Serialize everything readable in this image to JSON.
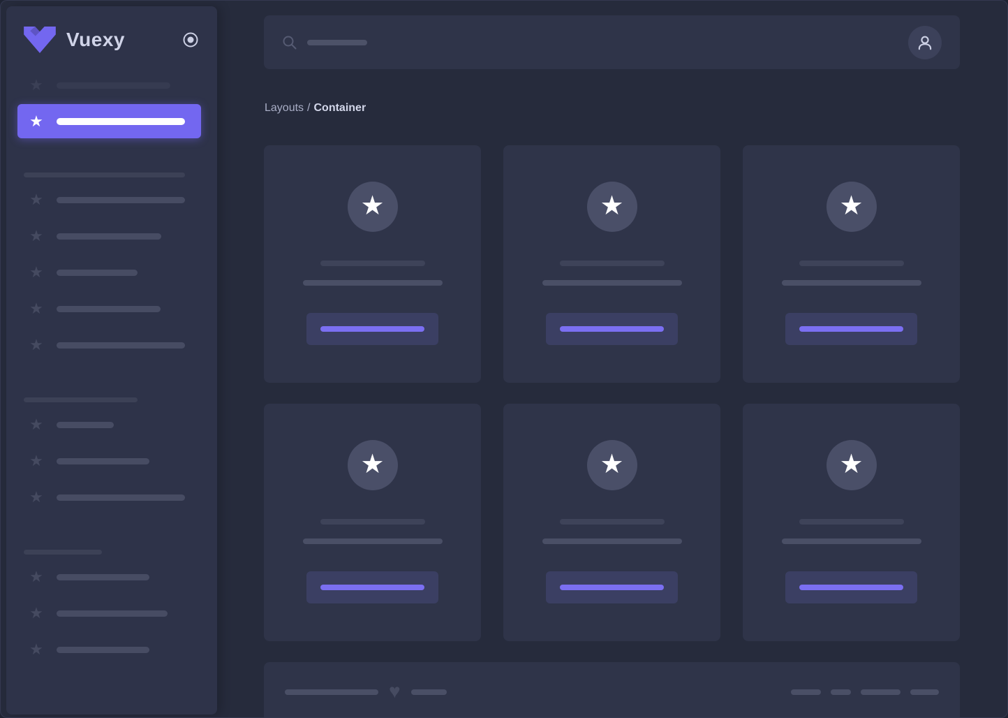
{
  "brand": {
    "name": "Vuexy"
  },
  "colors": {
    "accent": "#7367f0",
    "page_bg": "#262b3c",
    "sidebar_bg": "#2e3349",
    "card_bg": "#2f3449",
    "skeleton_bar": "#474c63",
    "button_bar": "#7b6ff2"
  },
  "icons": {
    "logo": "vuexy-v-logo",
    "collapse": "radio-circle",
    "search": "magnifier",
    "avatar": "person",
    "nav_item": "star",
    "card_avatar": "star",
    "footer": "heart"
  },
  "header": {
    "search_bar_style": "width:86px"
  },
  "breadcrumb": {
    "parent": "Layouts",
    "separator": "/",
    "current": "Container"
  },
  "sidebar": {
    "pre_item": {
      "bar_style": "width:163px"
    },
    "active_item": {
      "bar_style": "width:184px"
    },
    "sections": [
      {
        "header_style": "width:231px",
        "items": [
          {
            "bar_style": "width:184px"
          },
          {
            "bar_style": "width:150px"
          },
          {
            "bar_style": "width:116px"
          },
          {
            "bar_style": "width:149px"
          },
          {
            "bar_style": "width:184px"
          }
        ]
      },
      {
        "header_style": "width:163px",
        "items": [
          {
            "bar_style": "width:82px"
          },
          {
            "bar_style": "width:133px"
          },
          {
            "bar_style": "width:184px"
          }
        ]
      },
      {
        "header_style": "width:112px",
        "items": [
          {
            "bar_style": "width:133px"
          },
          {
            "bar_style": "width:159px"
          },
          {
            "bar_style": "width:133px"
          }
        ]
      }
    ]
  },
  "cards": {
    "count": 6,
    "line1_style": "width:150px",
    "line2_style": "width:200px",
    "button_bar_style": "width:149px"
  },
  "footer": {
    "bar1_style": "width:134px",
    "bar2_style": "width:51px",
    "right_bars": [
      {
        "style": "width:43px"
      },
      {
        "style": "width:29px"
      },
      {
        "style": "width:57px"
      },
      {
        "style": "width:41px"
      }
    ]
  }
}
